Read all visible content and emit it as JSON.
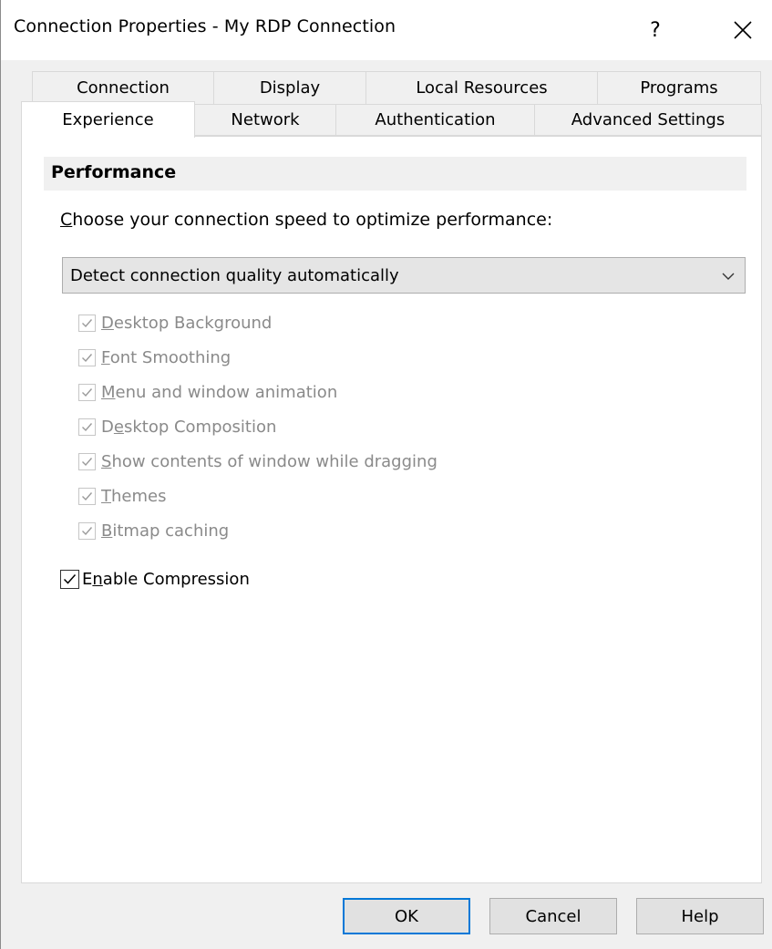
{
  "window": {
    "title": "Connection Properties - My RDP Connection",
    "help_glyph": "?",
    "close_glyph": "×"
  },
  "tabs": {
    "row_back": [
      {
        "label": "Connection"
      },
      {
        "label": "Display"
      },
      {
        "label": "Local Resources"
      },
      {
        "label": "Programs"
      }
    ],
    "row_front": [
      {
        "label": "Experience",
        "active": true
      },
      {
        "label": "Network"
      },
      {
        "label": "Authentication"
      },
      {
        "label": "Advanced Settings"
      }
    ]
  },
  "performance": {
    "header": "Performance",
    "speed_label_access_key": "C",
    "speed_label_rest": "hoose your connection speed to optimize performance:",
    "dropdown_value": "Detect connection quality automatically",
    "options": [
      {
        "key": "D",
        "rest": "esktop Background",
        "checked": true,
        "enabled": false
      },
      {
        "key": "F",
        "rest": "ont Smoothing",
        "checked": true,
        "enabled": false
      },
      {
        "key": "M",
        "rest": "enu and window animation",
        "checked": true,
        "enabled": false
      },
      {
        "pre": "D",
        "key": "e",
        "rest": "sktop Composition",
        "checked": true,
        "enabled": false
      },
      {
        "key": "S",
        "rest": "how contents of window while dragging",
        "checked": true,
        "enabled": false
      },
      {
        "key": "T",
        "rest": "hemes",
        "checked": true,
        "enabled": false
      },
      {
        "key": "B",
        "rest": "itmap caching",
        "checked": true,
        "enabled": false
      }
    ],
    "compression": {
      "pre": "E",
      "key": "n",
      "rest": "able Compression",
      "checked": true,
      "enabled": true
    }
  },
  "buttons": {
    "ok": "OK",
    "cancel": "Cancel",
    "help": "Help"
  },
  "colors": {
    "accent": "#0078d7",
    "disabled_text": "#8a8a8a"
  }
}
